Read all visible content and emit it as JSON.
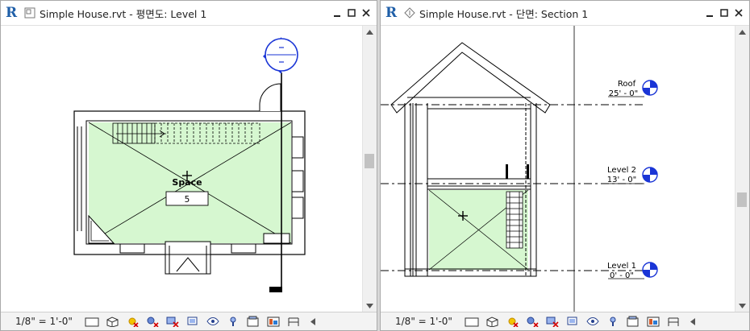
{
  "left_view": {
    "title": "Simple House.rvt - 평면도: Level 1",
    "room_label": "Space",
    "room_number": "5",
    "scale": "1/8\" = 1'-0\""
  },
  "right_view": {
    "title": "Simple House.rvt - 단면: Section 1",
    "levels": [
      {
        "name": "Roof",
        "elevation": "25' - 0\""
      },
      {
        "name": "Level 2",
        "elevation": "13' - 0\""
      },
      {
        "name": "Level 1",
        "elevation": "0' - 0\""
      }
    ],
    "scale": "1/8\" = 1'-0\""
  },
  "colors": {
    "room_fill": "#d6f7d0",
    "marker_blue": "#1a35d6",
    "logo_blue": "#1f5fa8"
  },
  "icons": {
    "view_control_bar": [
      "detail-level-icon",
      "visual-style-icon",
      "sun-path-icon",
      "shadows-icon",
      "crop-view-icon",
      "show-crop-icon",
      "temporary-hide-icon",
      "reveal-hidden-icon",
      "temporary-view-properties-icon",
      "render-icon",
      "analytical-model-icon"
    ]
  }
}
